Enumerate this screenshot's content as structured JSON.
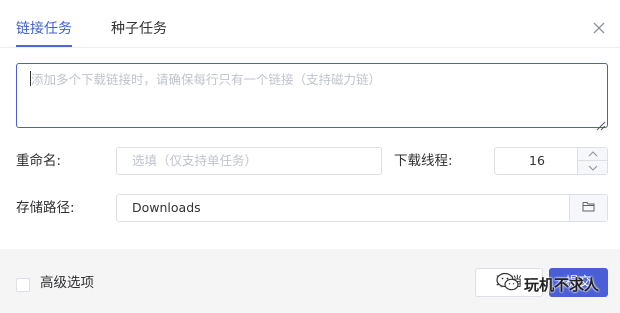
{
  "tabs": {
    "link_task": "链接任务",
    "seed_task": "种子任务"
  },
  "url_input": {
    "placeholder": "添加多个下载链接时，请确保每行只有一个链接（支持磁力链）"
  },
  "rename": {
    "label": "重命名:",
    "placeholder": "选填（仅支持单任务）"
  },
  "threads": {
    "label": "下载线程:",
    "value": "16"
  },
  "save_path": {
    "label": "存储路径:",
    "value": "Downloads"
  },
  "advanced": {
    "label": "高级选项",
    "checked": false
  },
  "buttons": {
    "cancel": "取消",
    "ok": "提交"
  },
  "watermark": {
    "text": "玩机不求人"
  },
  "colors": {
    "accent": "#4a5fd6",
    "footer_bg": "#f5f5f6"
  }
}
